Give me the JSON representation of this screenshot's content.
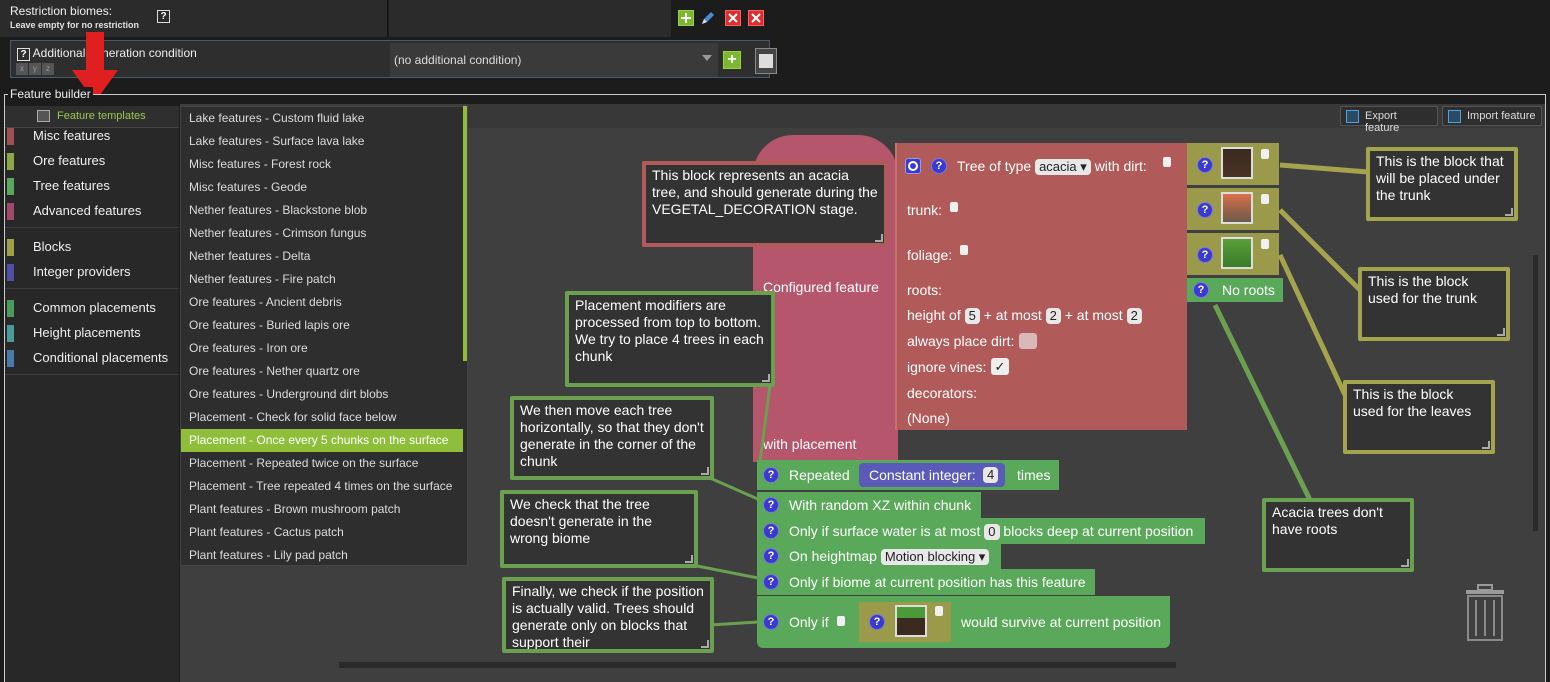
{
  "top": {
    "restriction_label": "Restriction biomes:",
    "restriction_hint": "Leave empty for no restriction",
    "help_glyph": "?",
    "additional_condition_label": "Additional generation condition",
    "xyz": [
      "x",
      "y",
      "z"
    ],
    "condition_value": "(no additional condition)",
    "add_glyph": "+"
  },
  "feature_builder": {
    "title": "Feature builder",
    "templates_button": "Feature templates",
    "export_button": "Export feature",
    "import_button": "Import feature"
  },
  "categories": [
    {
      "label": "Misc features",
      "color": "#a05050"
    },
    {
      "label": "Ore features",
      "color": "#8aa84a"
    },
    {
      "label": "Tree features",
      "color": "#5aa85a"
    },
    {
      "label": "Advanced features",
      "color": "#a0486a"
    },
    {
      "label": "Blocks",
      "color": "#a0a04a"
    },
    {
      "label": "Integer providers",
      "color": "#5050a8"
    },
    {
      "label": "Common placements",
      "color": "#4a9a5a"
    },
    {
      "label": "Height placements",
      "color": "#4a9a9a"
    },
    {
      "label": "Conditional placements",
      "color": "#4a7aaa"
    }
  ],
  "templates": [
    "Lake features - Custom fluid lake",
    "Lake features - Surface lava lake",
    "Misc features - Forest rock",
    "Misc features - Geode",
    "Nether features - Blackstone blob",
    "Nether features - Crimson fungus",
    "Nether features - Delta",
    "Nether features - Fire patch",
    "Ore features - Ancient debris",
    "Ore features - Buried lapis ore",
    "Ore features - Iron ore",
    "Ore features - Nether quartz ore",
    "Ore features - Underground dirt blobs",
    "Placement - Check for solid face below",
    "Placement - Once every 5 chunks on the surface",
    "Placement - Repeated twice on the surface",
    "Placement - Tree repeated 4 times on the surface",
    "Plant features - Brown mushroom patch",
    "Plant features - Cactus patch",
    "Plant features - Lily pad patch"
  ],
  "selected_template_index": 14,
  "blocks": {
    "configured_feature": "Configured feature",
    "with_placement": "with placement",
    "tree_prefix": "Tree of type",
    "tree_type": "acacia",
    "with_dirt": "with dirt:",
    "trunk": "trunk:",
    "foliage": "foliage:",
    "roots": "roots:",
    "no_roots": "No roots",
    "height_of": "height of",
    "height_base": "5",
    "at_most_label": "+ at most",
    "height_rand_a": "2",
    "height_rand_b": "2",
    "always_place_dirt": "always place dirt:",
    "ignore_vines": "ignore vines:",
    "check_glyph": "✓",
    "decorators": "decorators:",
    "none": "(None)",
    "repeated": "Repeated",
    "constant_integer": "Constant integer:",
    "repeat_count": "4",
    "times": "times",
    "random_xz": "With random XZ within chunk",
    "surface_water_a": "Only if surface water is at most",
    "surface_water_depth": "0",
    "surface_water_b": "blocks deep at current position",
    "on_heightmap": "On heightmap",
    "heightmap_value": "Motion blocking",
    "biome_check": "Only if biome at current position has this feature",
    "only_if": "Only if",
    "would_survive": "would survive at current position"
  },
  "comments": {
    "acacia": "This block represents an acacia tree, and should generate during the VEGETAL_DECORATION stage.",
    "placement": "Placement modifiers are processed from top to bottom. We try to place 4 trees in each chunk",
    "move": "We then move each tree horizontally, so that they don't generate in the corner of the chunk",
    "biome": "We check that the tree doesn't generate in the wrong biome",
    "valid": "Finally, we check if the position is actually valid. Trees should generate only on blocks that support their",
    "dirt": "This is the block that will be placed under the trunk",
    "trunk": "This is the block used for the trunk",
    "leaves": "This is the block used for the leaves",
    "roots": "Acacia trees don't have roots"
  },
  "icons": {
    "trash": "trash-icon",
    "arrow": "red-down-arrow-icon"
  },
  "colors": {
    "accent_green": "#8fbf3a",
    "feature_pink": "#b6566c",
    "tree_red": "#b05a5a",
    "placement_green": "#5aa85a",
    "block_olive": "#9a9a4a",
    "integer_blue": "#5a5ab8"
  }
}
